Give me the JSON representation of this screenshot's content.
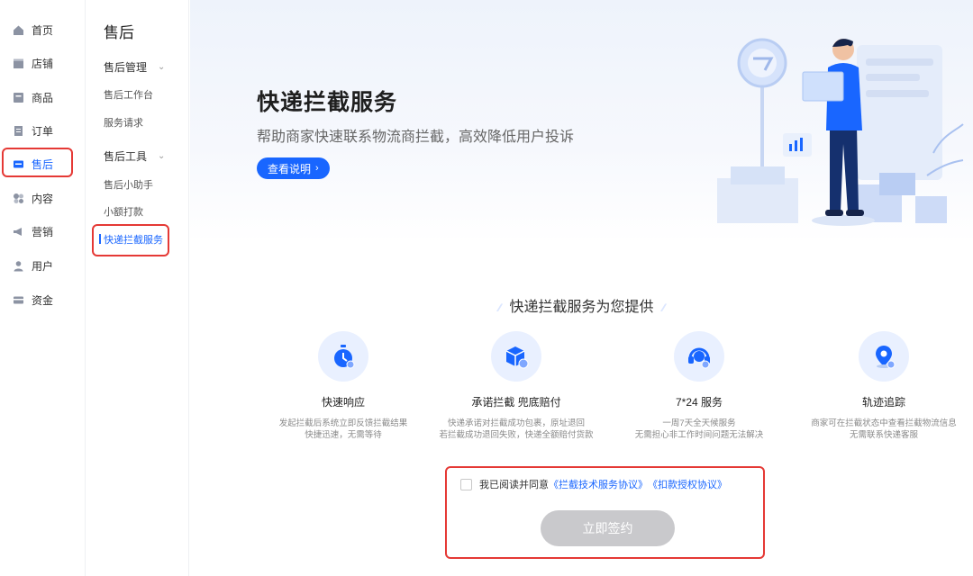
{
  "nav": {
    "items": [
      {
        "label": "首页",
        "icon": "home-icon"
      },
      {
        "label": "店铺",
        "icon": "shop-icon"
      },
      {
        "label": "商品",
        "icon": "goods-icon"
      },
      {
        "label": "订单",
        "icon": "order-icon"
      },
      {
        "label": "售后",
        "icon": "aftersale-icon"
      },
      {
        "label": "内容",
        "icon": "content-icon"
      },
      {
        "label": "营销",
        "icon": "marketing-icon"
      },
      {
        "label": "用户",
        "icon": "user-icon"
      },
      {
        "label": "资金",
        "icon": "funds-icon"
      }
    ],
    "active_index": 4
  },
  "subnav": {
    "title": "售后",
    "groups": [
      {
        "label": "售后管理",
        "items": [
          "售后工作台",
          "服务请求"
        ]
      },
      {
        "label": "售后工具",
        "items": [
          "售后小助手",
          "小额打款",
          "快递拦截服务"
        ]
      }
    ],
    "active_item": "快递拦截服务"
  },
  "hero": {
    "title": "快递拦截服务",
    "subtitle": "帮助商家快速联系物流商拦截，高效降低用户投诉",
    "button": "查看说明"
  },
  "section": {
    "title": "快递拦截服务为您提供"
  },
  "features": [
    {
      "name": "快速响应",
      "desc": "发起拦截后系统立即反馈拦截结果\n快捷迅速，无需等待",
      "icon": "stopwatch-icon"
    },
    {
      "name": "承诺拦截 兜底赔付",
      "desc": "快递承诺对拦截成功包裹，原址退回\n若拦截成功退回失败，快递全额赔付货款",
      "icon": "package-shield-icon"
    },
    {
      "name": "7*24 服务",
      "desc": "一周7天全天候服务\n无需担心非工作时间问题无法解决",
      "icon": "headset-icon"
    },
    {
      "name": "轨迹追踪",
      "desc": "商家可在拦截状态中查看拦截物流信息\n无需联系快递客服",
      "icon": "location-pin-icon"
    }
  ],
  "agreement": {
    "prefix": "我已阅读并同意",
    "link1": "《拦截技术服务协议》",
    "link2": "《扣款授权协议》",
    "checked": false
  },
  "sign_button": "立即签约",
  "colors": {
    "accent": "#1966ff",
    "highlight": "#e53935",
    "disabled": "#c9c9cc"
  }
}
